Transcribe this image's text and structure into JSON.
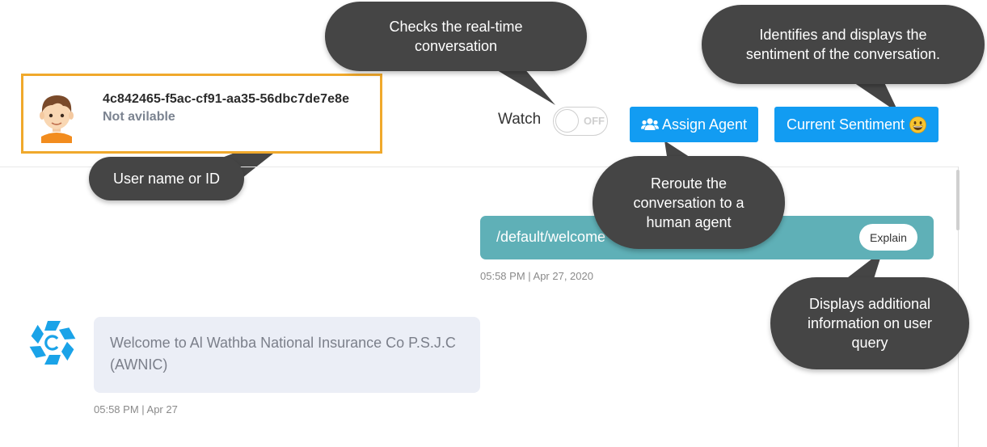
{
  "header": {
    "user": {
      "id": "4c842465-f5ac-cf91-aa35-56dbc7de7e8e",
      "status": "Not avilable"
    },
    "watch": {
      "label": "Watch",
      "state": "OFF"
    },
    "assign_agent_label": "Assign Agent",
    "current_sentiment_label": "Current Sentiment",
    "sentiment_emoji": "😀"
  },
  "chat": {
    "user_message": {
      "text": "/default/welcome",
      "explain_label": "Explain",
      "time": "05:58 PM | Apr 27, 2020"
    },
    "bot_message": {
      "text": "Welcome to Al Wathba National Insurance Co P.S.J.C (AWNIC)",
      "time": "05:58 PM | Apr 27"
    }
  },
  "callouts": {
    "realtime": "Checks the real-time conversation",
    "sentiment": "Identifies and displays the sentiment of the conversation.",
    "user": "User name or ID",
    "reroute": "Reroute the conversation to a human agent",
    "explain": "Displays additional information on user query"
  },
  "colors": {
    "accent_blue": "#129cf2",
    "user_bubble": "#5fb0b7",
    "bot_bubble": "#ebeef6",
    "highlight_border": "#f0a92c",
    "callout_bg": "#454545"
  },
  "icons": {
    "assign_agent": "users-icon",
    "bot": "bot-logo-icon",
    "avatar": "user-avatar"
  }
}
